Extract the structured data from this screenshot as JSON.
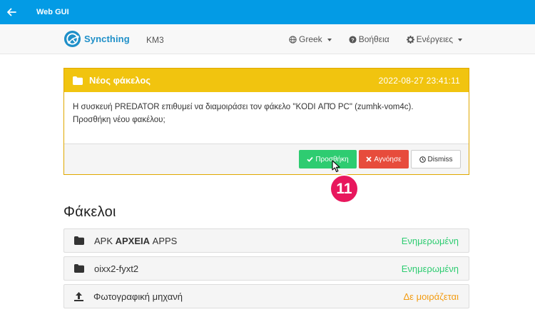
{
  "appbar": {
    "title": "Web GUI"
  },
  "navbar": {
    "brand": "Syncthing",
    "device": "KM3",
    "language": "Greek",
    "help": "Βοήθεια",
    "actions": "Ενέργειες"
  },
  "notice": {
    "title": "Νέος φάκελος",
    "timestamp": "2022-08-27 23:41:11",
    "message_line1": "Η συσκευή PREDATOR επιθυμεί να διαμοιράσει τον φάκελο \"KODI ΑΠΌ PC\" (zumhk-vom4c).",
    "message_line2": "Προσθήκη νέου φακέλου;",
    "add_label": "Προσθήκη",
    "ignore_label": "Αγνόησε",
    "dismiss_label": "Dismiss"
  },
  "step_badge": "11",
  "folders": {
    "heading": "Φάκελοι",
    "items": [
      {
        "name_prefix": "APK ",
        "name_bold": "ΑΡΧΕΙΑ",
        "name_suffix": " APPS",
        "status": "Ενημερωμένη",
        "icon": "folder-icon"
      },
      {
        "name_prefix": "oixx2-fyxt2",
        "name_bold": "",
        "name_suffix": "",
        "status": "Ενημερωμένη",
        "icon": "folder-icon"
      },
      {
        "name_prefix": "Φωτογραφική μηχανή",
        "name_bold": "",
        "name_suffix": "",
        "status": "Δε μοιράζεται",
        "icon": "upload-icon"
      }
    ]
  },
  "colors": {
    "appbar": "#039be5",
    "brand": "#1e8fc8",
    "warning": "#f1c40f",
    "success": "#2ecc71",
    "danger": "#e74c3c",
    "badge": "#e8175d"
  }
}
